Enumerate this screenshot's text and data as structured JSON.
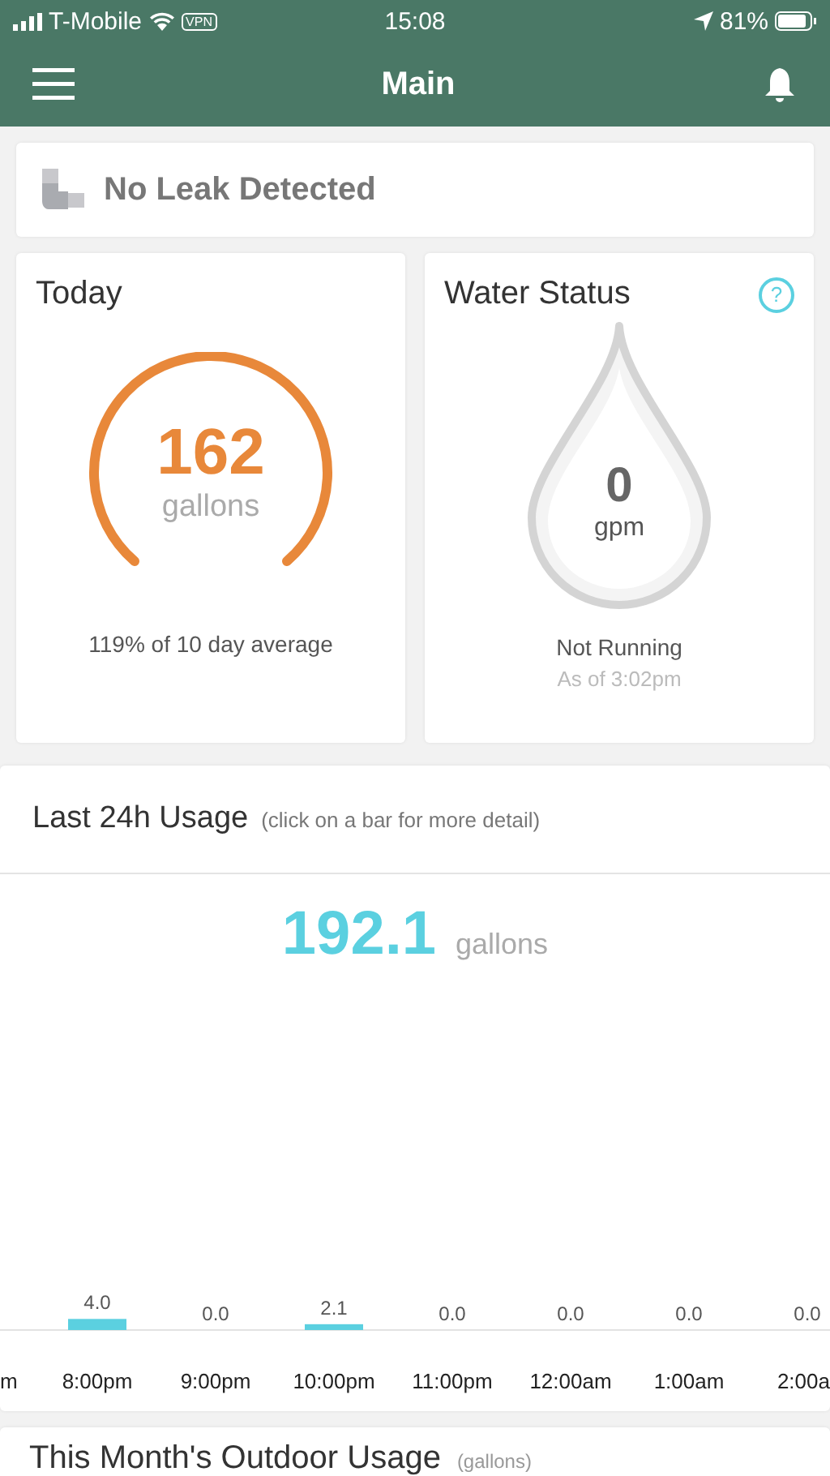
{
  "status_bar": {
    "carrier": "T-Mobile",
    "vpn": "VPN",
    "time": "15:08",
    "battery": "81%"
  },
  "header": {
    "title": "Main"
  },
  "leak": {
    "text": "No Leak Detected"
  },
  "today": {
    "title": "Today",
    "value": "162",
    "unit": "gallons",
    "note": "119% of 10 day average"
  },
  "water_status": {
    "title": "Water Status",
    "help": "?",
    "value": "0",
    "unit": "gpm",
    "state": "Not Running",
    "as_of": "As of 3:02pm"
  },
  "usage": {
    "title": "Last 24h Usage",
    "hint": "(click on a bar for more detail)",
    "total": "192.1",
    "unit": "gallons",
    "chart_data": {
      "type": "bar",
      "categories": [
        "m",
        "8:00pm",
        "9:00pm",
        "10:00pm",
        "11:00pm",
        "12:00am",
        "1:00am",
        "2:00a"
      ],
      "series": [
        {
          "color": "#5bd0e0",
          "values": [
            null,
            4.0,
            0.0,
            2.1,
            0.0,
            0.0,
            0.0,
            0.0
          ],
          "value_labels": [
            null,
            "4.0",
            "0.0",
            "2.1",
            "0.0",
            "0.0",
            "0.0",
            "0.0"
          ]
        }
      ],
      "data_labels": true
    }
  },
  "outdoor": {
    "title": "This Month's Outdoor Usage",
    "hint": "(gallons)"
  }
}
